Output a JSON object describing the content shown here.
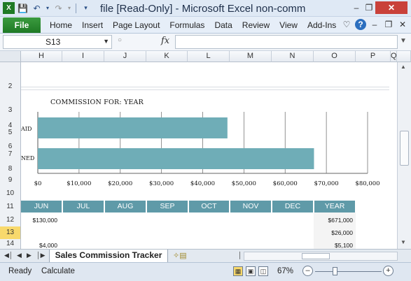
{
  "window": {
    "title": "file  [Read-Only]  -  Microsoft Excel non-comm",
    "qat_icons": [
      "excel-logo-icon",
      "save-icon",
      "undo-icon",
      "redo-icon",
      "customize-qat-icon"
    ]
  },
  "ribbon": {
    "file_label": "File",
    "tabs": [
      "Home",
      "Insert",
      "Page Layout",
      "Formulas",
      "Data",
      "Review",
      "View",
      "Add-Ins"
    ],
    "file_color": "#2a8a31"
  },
  "formula_bar": {
    "name_box": "S13",
    "fx_label": "fx",
    "formula": ""
  },
  "columns": [
    "H",
    "I",
    "J",
    "K",
    "L",
    "M",
    "N",
    "O",
    "P",
    "Q"
  ],
  "rows": [
    "2",
    "3",
    "4",
    "5",
    "6",
    "7",
    "8",
    "9",
    "10",
    "11",
    "12",
    "13",
    "14"
  ],
  "selected_row": "13",
  "chart_data": {
    "type": "bar",
    "orientation": "horizontal",
    "title": "COMMISSION FOR:  YEAR",
    "categories": [
      "AID",
      "NED"
    ],
    "values": [
      46000,
      67000
    ],
    "xlim": [
      0,
      80000
    ],
    "xticks": [
      "$0",
      "$10,000",
      "$20,000",
      "$30,000",
      "$40,000",
      "$50,000",
      "$60,000",
      "$70,000",
      "$80,000"
    ],
    "grid": true,
    "bar_color": "#6fadb7"
  },
  "table": {
    "headers": [
      "JUN",
      "JUL",
      "AUG",
      "SEP",
      "OCT",
      "NOV",
      "DEC",
      "YEAR"
    ],
    "header_color": "#5f9aa8",
    "row12": {
      "jun": "$130,000",
      "year": "$671,000"
    },
    "row13": {
      "year": "$26,000"
    },
    "row14": {
      "jun": "$4,000",
      "year": "$5,100"
    }
  },
  "sheet_tab": {
    "active": "Sales Commission Tracker"
  },
  "status": {
    "ready": "Ready",
    "calculate": "Calculate",
    "zoom": "67%",
    "zoom_fraction": 0.5
  }
}
